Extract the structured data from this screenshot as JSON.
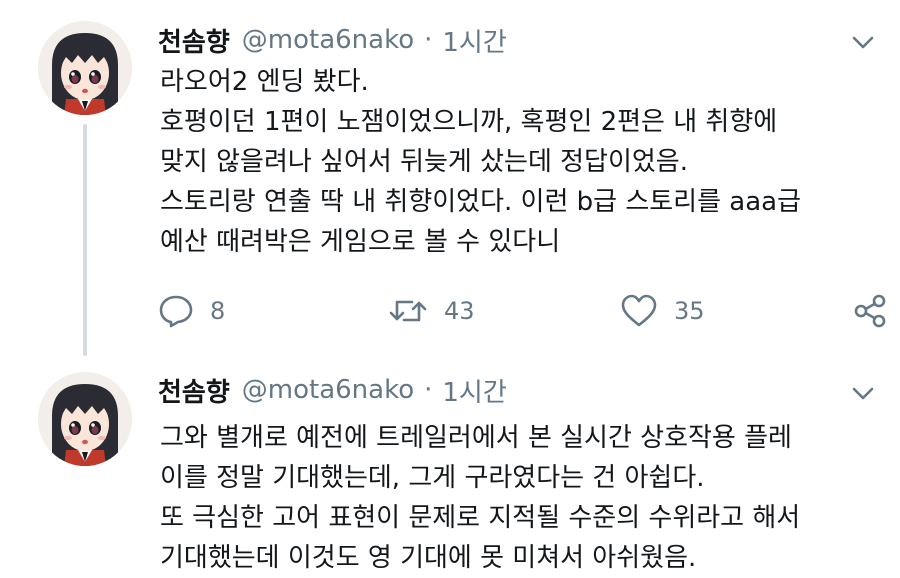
{
  "tweets": [
    {
      "author_name": "천솜향",
      "handle": "@mota6nako",
      "separator": "·",
      "time": "1시간",
      "lines": [
        "라오어2 엔딩 봤다.",
        "호평이던 1편이 노잼이었으니까, 혹평인 2편은 내 취향에",
        "맞지 않을려나 싶어서 뒤늦게 샀는데 정답이었음.",
        "스토리랑 연출 딱 내 취향이었다. 이런 b급 스토리를 aaa급",
        "예산 때려박은 게임으로 볼 수 있다니"
      ],
      "reply_count": "8",
      "retweet_count": "43",
      "like_count": "35"
    },
    {
      "author_name": "천솜향",
      "handle": "@mota6nako",
      "separator": "·",
      "time": "1시간",
      "lines": [
        "그와 별개로 예전에 트레일러에서 본 실시간 상호작용 플레",
        "이를 정말 기대했는데, 그게 구라였다는 건 아쉽다.",
        "또 극심한 고어 표현이 문제로 지적될 수준의 수위라고 해서",
        "기대했는데 이것도 영 기대에 못 미쳐서 아쉬웠음."
      ]
    }
  ],
  "icons": {
    "reply": "speech-bubble",
    "retweet": "retweet-arrows",
    "like": "heart-outline",
    "share": "share-nodes",
    "menu": "chevron-down"
  },
  "colors": {
    "text": "#14171a",
    "secondary": "#657786",
    "thread_line": "#d6dbe0"
  }
}
